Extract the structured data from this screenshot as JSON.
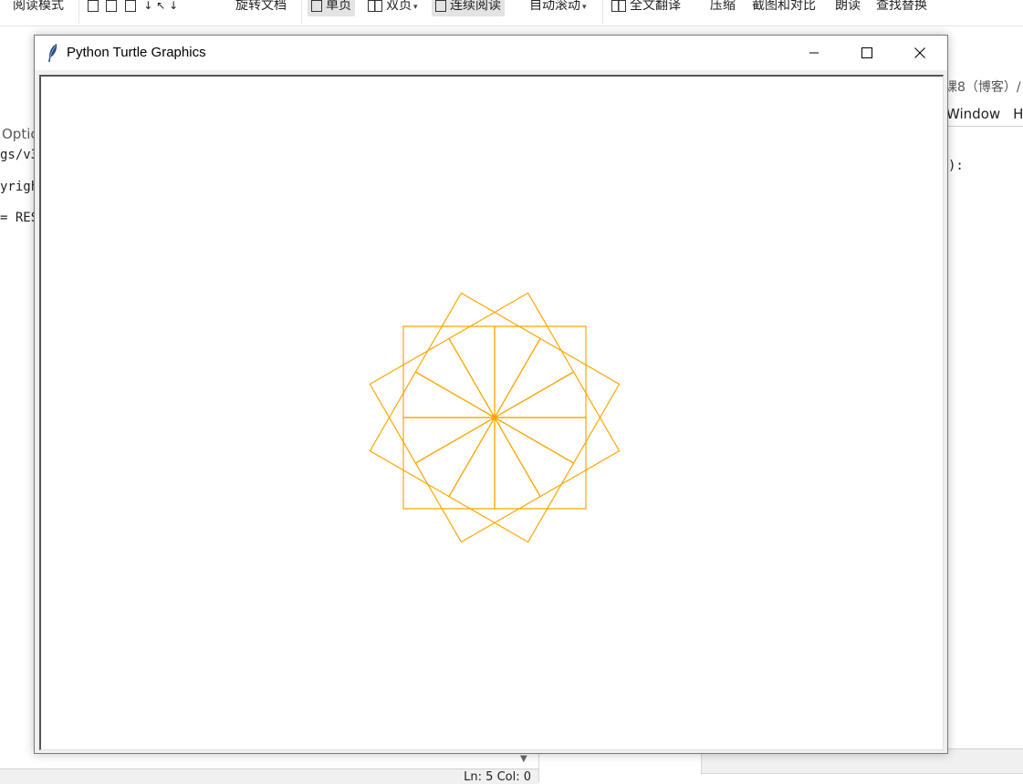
{
  "reader_toolbar": {
    "read_mode": "阅读模式",
    "rotate_doc": "旋转文档",
    "single_page": "单页",
    "double_page": "双页",
    "continuous_read": "连续阅读",
    "auto_scroll": "自动滚动",
    "translate_full": "全文翻译",
    "compress": "压缩",
    "screenshot_compare": "截图和对比",
    "read_aloud": "朗读",
    "find_replace": "查找替换"
  },
  "shell_window": {
    "menu_fragment": "Optic",
    "lines": [
      "gs/v3",
      "yrigh",
      "= RES"
    ],
    "status": "Ln: 5   Col: 0"
  },
  "editor_window": {
    "title_fragment": "课8（博客）/",
    "menu": [
      "Window",
      "H"
    ],
    "code_fragment": "):"
  },
  "turtle_window": {
    "title": "Python Turtle Graphics",
    "drawing": {
      "shape": "square",
      "square_count": 12,
      "rotation_step_degrees": 30,
      "stroke_color": "#ffa500",
      "background": "#ffffff"
    }
  },
  "colors": {
    "turtle_pen": "#ffa500",
    "window_border": "#7a7a7a",
    "titlebar": "#ffffff"
  }
}
